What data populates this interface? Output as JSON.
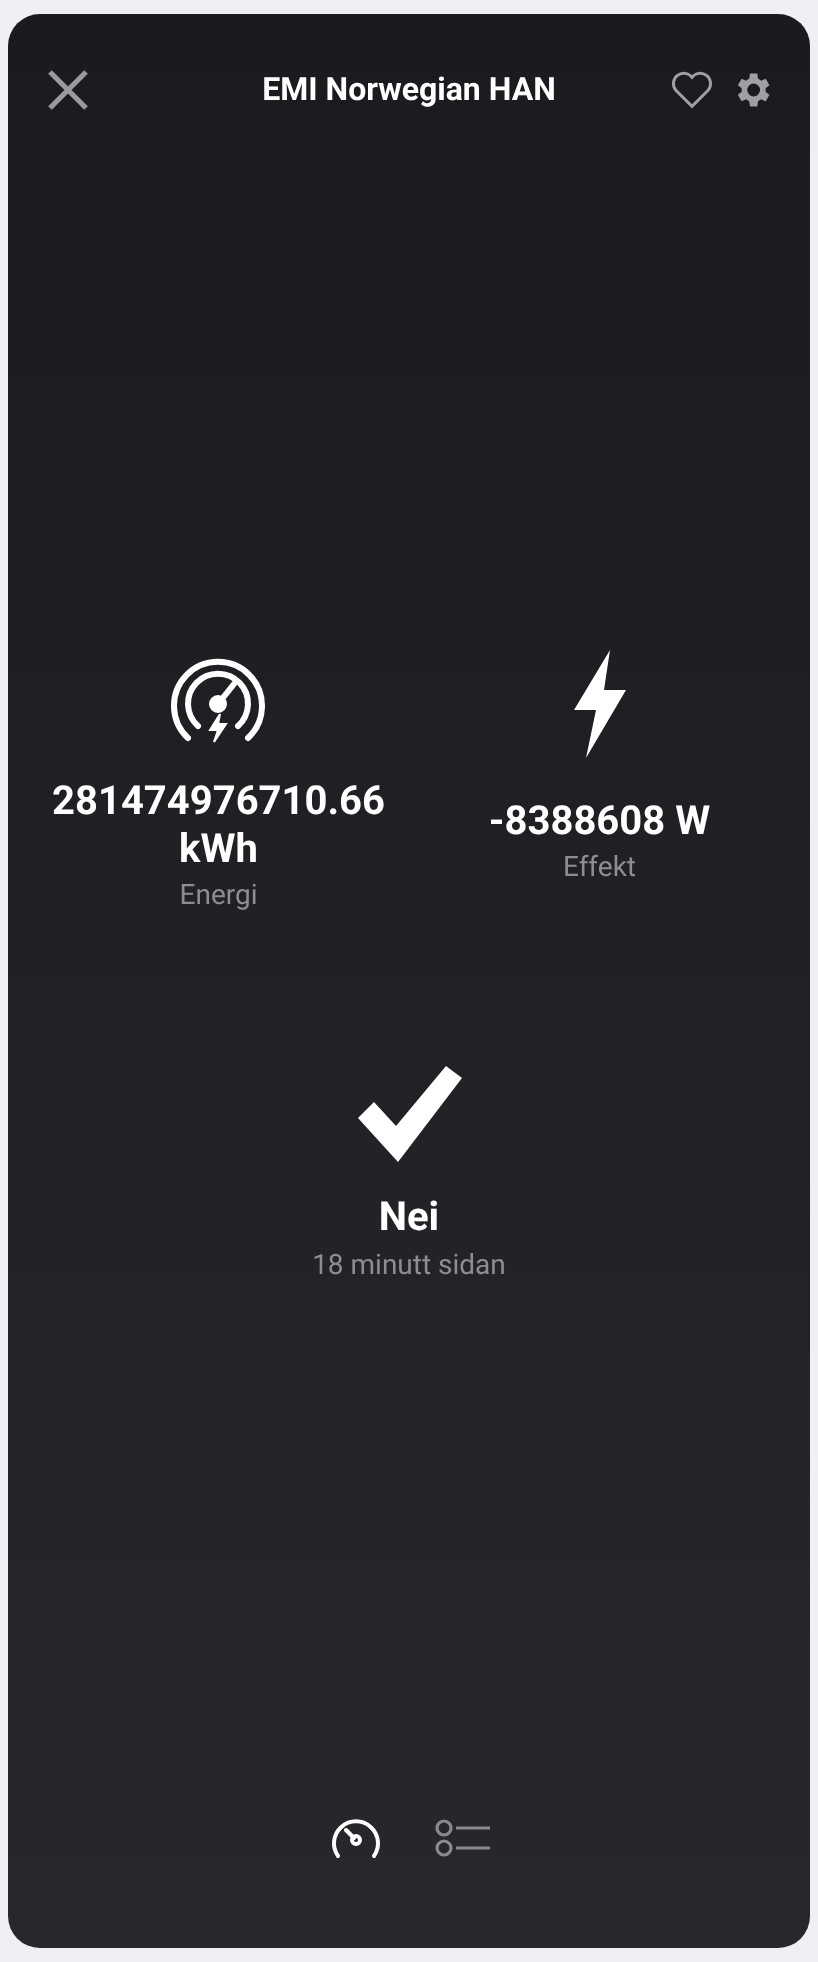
{
  "header": {
    "title": "EMI Norwegian HAN"
  },
  "tiles": [
    {
      "kind": "energy",
      "value": "281474976710.66 kWh",
      "label": "Energi"
    },
    {
      "kind": "power",
      "value": "-8388608 W",
      "label": "Effekt"
    }
  ],
  "status": {
    "kind": "check",
    "value": "Nei",
    "time": "18 minutt sidan"
  },
  "tabs": [
    {
      "kind": "gauge",
      "selected": true
    },
    {
      "kind": "list",
      "selected": false
    }
  ]
}
